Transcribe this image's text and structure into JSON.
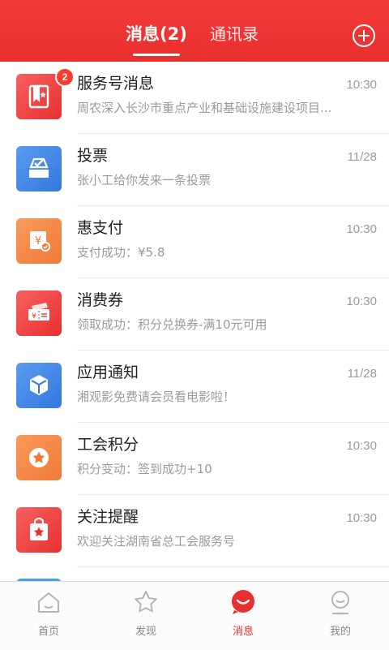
{
  "header": {
    "tab_messages": "消息(2)",
    "tab_contacts": "通讯录"
  },
  "messages": [
    {
      "title": "服务号消息",
      "subtitle": "周农深入长沙市重点产业和基础设施建设项目...",
      "time": "10:30",
      "badge": "2",
      "icon": "bookmark-star-icon",
      "color": "#f04848"
    },
    {
      "title": "投票",
      "subtitle": "张小工给你发来一条投票",
      "time": "11/28",
      "icon": "ballot-box-icon",
      "color": "#3d86e6"
    },
    {
      "title": "惠支付",
      "subtitle": "支付成功：¥5.8",
      "time": "10:30",
      "icon": "yuan-payment-icon",
      "color": "#f58a4a"
    },
    {
      "title": "消费券",
      "subtitle": "领取成功：积分兑换券-满10元可用",
      "time": "10:30",
      "icon": "coupon-icon",
      "color": "#f04848"
    },
    {
      "title": "应用通知",
      "subtitle": "湘观影免费请会员看电影啦！",
      "time": "11/28",
      "icon": "cube-icon",
      "color": "#3d86e6"
    },
    {
      "title": "工会积分",
      "subtitle": "积分变动：签到成功+10",
      "time": "10:30",
      "icon": "star-circle-icon",
      "color": "#f58a4a"
    },
    {
      "title": "关注提醒",
      "subtitle": "欢迎关注湖南省总工会服务号",
      "time": "10:30",
      "icon": "bag-star-icon",
      "color": "#f04848"
    }
  ],
  "tabbar": [
    {
      "label": "首页",
      "icon": "home-icon"
    },
    {
      "label": "发现",
      "icon": "star-icon"
    },
    {
      "label": "消息",
      "icon": "message-bubble-icon",
      "active": true
    },
    {
      "label": "我的",
      "icon": "profile-icon"
    }
  ],
  "colors": {
    "accent": "#e83030",
    "blue": "#3d86e6",
    "orange": "#f58a4a"
  }
}
